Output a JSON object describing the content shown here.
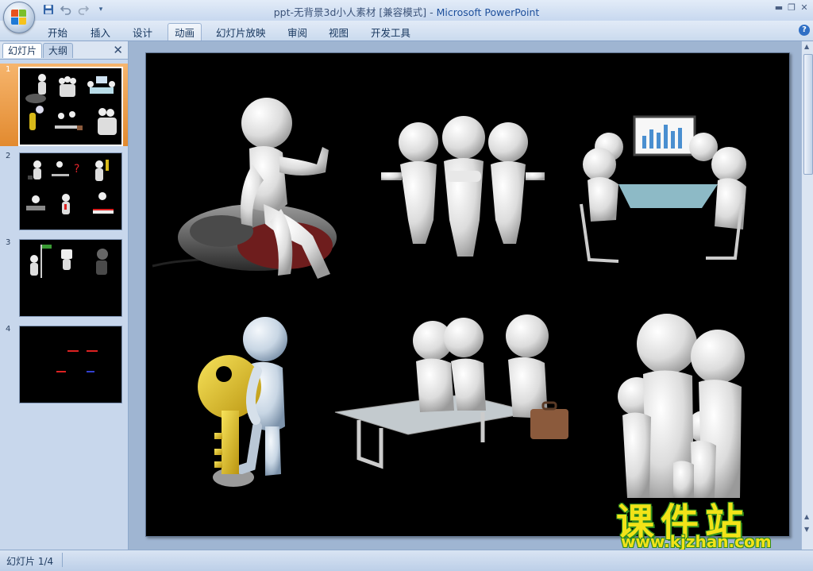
{
  "window": {
    "title_doc": "ppt-无背景3d小人素材 [兼容模式] - ",
    "title_app": "Microsoft PowerPoint"
  },
  "ribbon": {
    "tabs": [
      "开始",
      "插入",
      "设计",
      "动画",
      "幻灯片放映",
      "审阅",
      "视图",
      "开发工具"
    ],
    "active_tab": "动画"
  },
  "left_pane": {
    "tabs": [
      "幻灯片",
      "大纲"
    ],
    "close_glyph": "✕",
    "slides": [
      {
        "number": "1",
        "selected": true
      },
      {
        "number": "2",
        "selected": false
      },
      {
        "number": "3",
        "selected": false
      },
      {
        "number": "4",
        "selected": false
      }
    ]
  },
  "status": {
    "slide_indicator": "幻灯片 1/4"
  },
  "watermark": {
    "brand": "课件站",
    "url": "www.kjzhan.com"
  },
  "colors": {
    "slide_background": "#000000",
    "selected_thumb": "#e28a2f",
    "watermark_fill": "#f2e318",
    "watermark_outline": "#2e8b1f"
  },
  "icons": [
    "office-button-icon",
    "save-icon",
    "undo-icon",
    "redo-icon",
    "customize-qat-icon",
    "minimize-icon",
    "restore-icon",
    "close-icon",
    "help-icon",
    "pane-close-icon",
    "scroll-up-icon",
    "prev-slide-icon",
    "next-slide-icon"
  ]
}
